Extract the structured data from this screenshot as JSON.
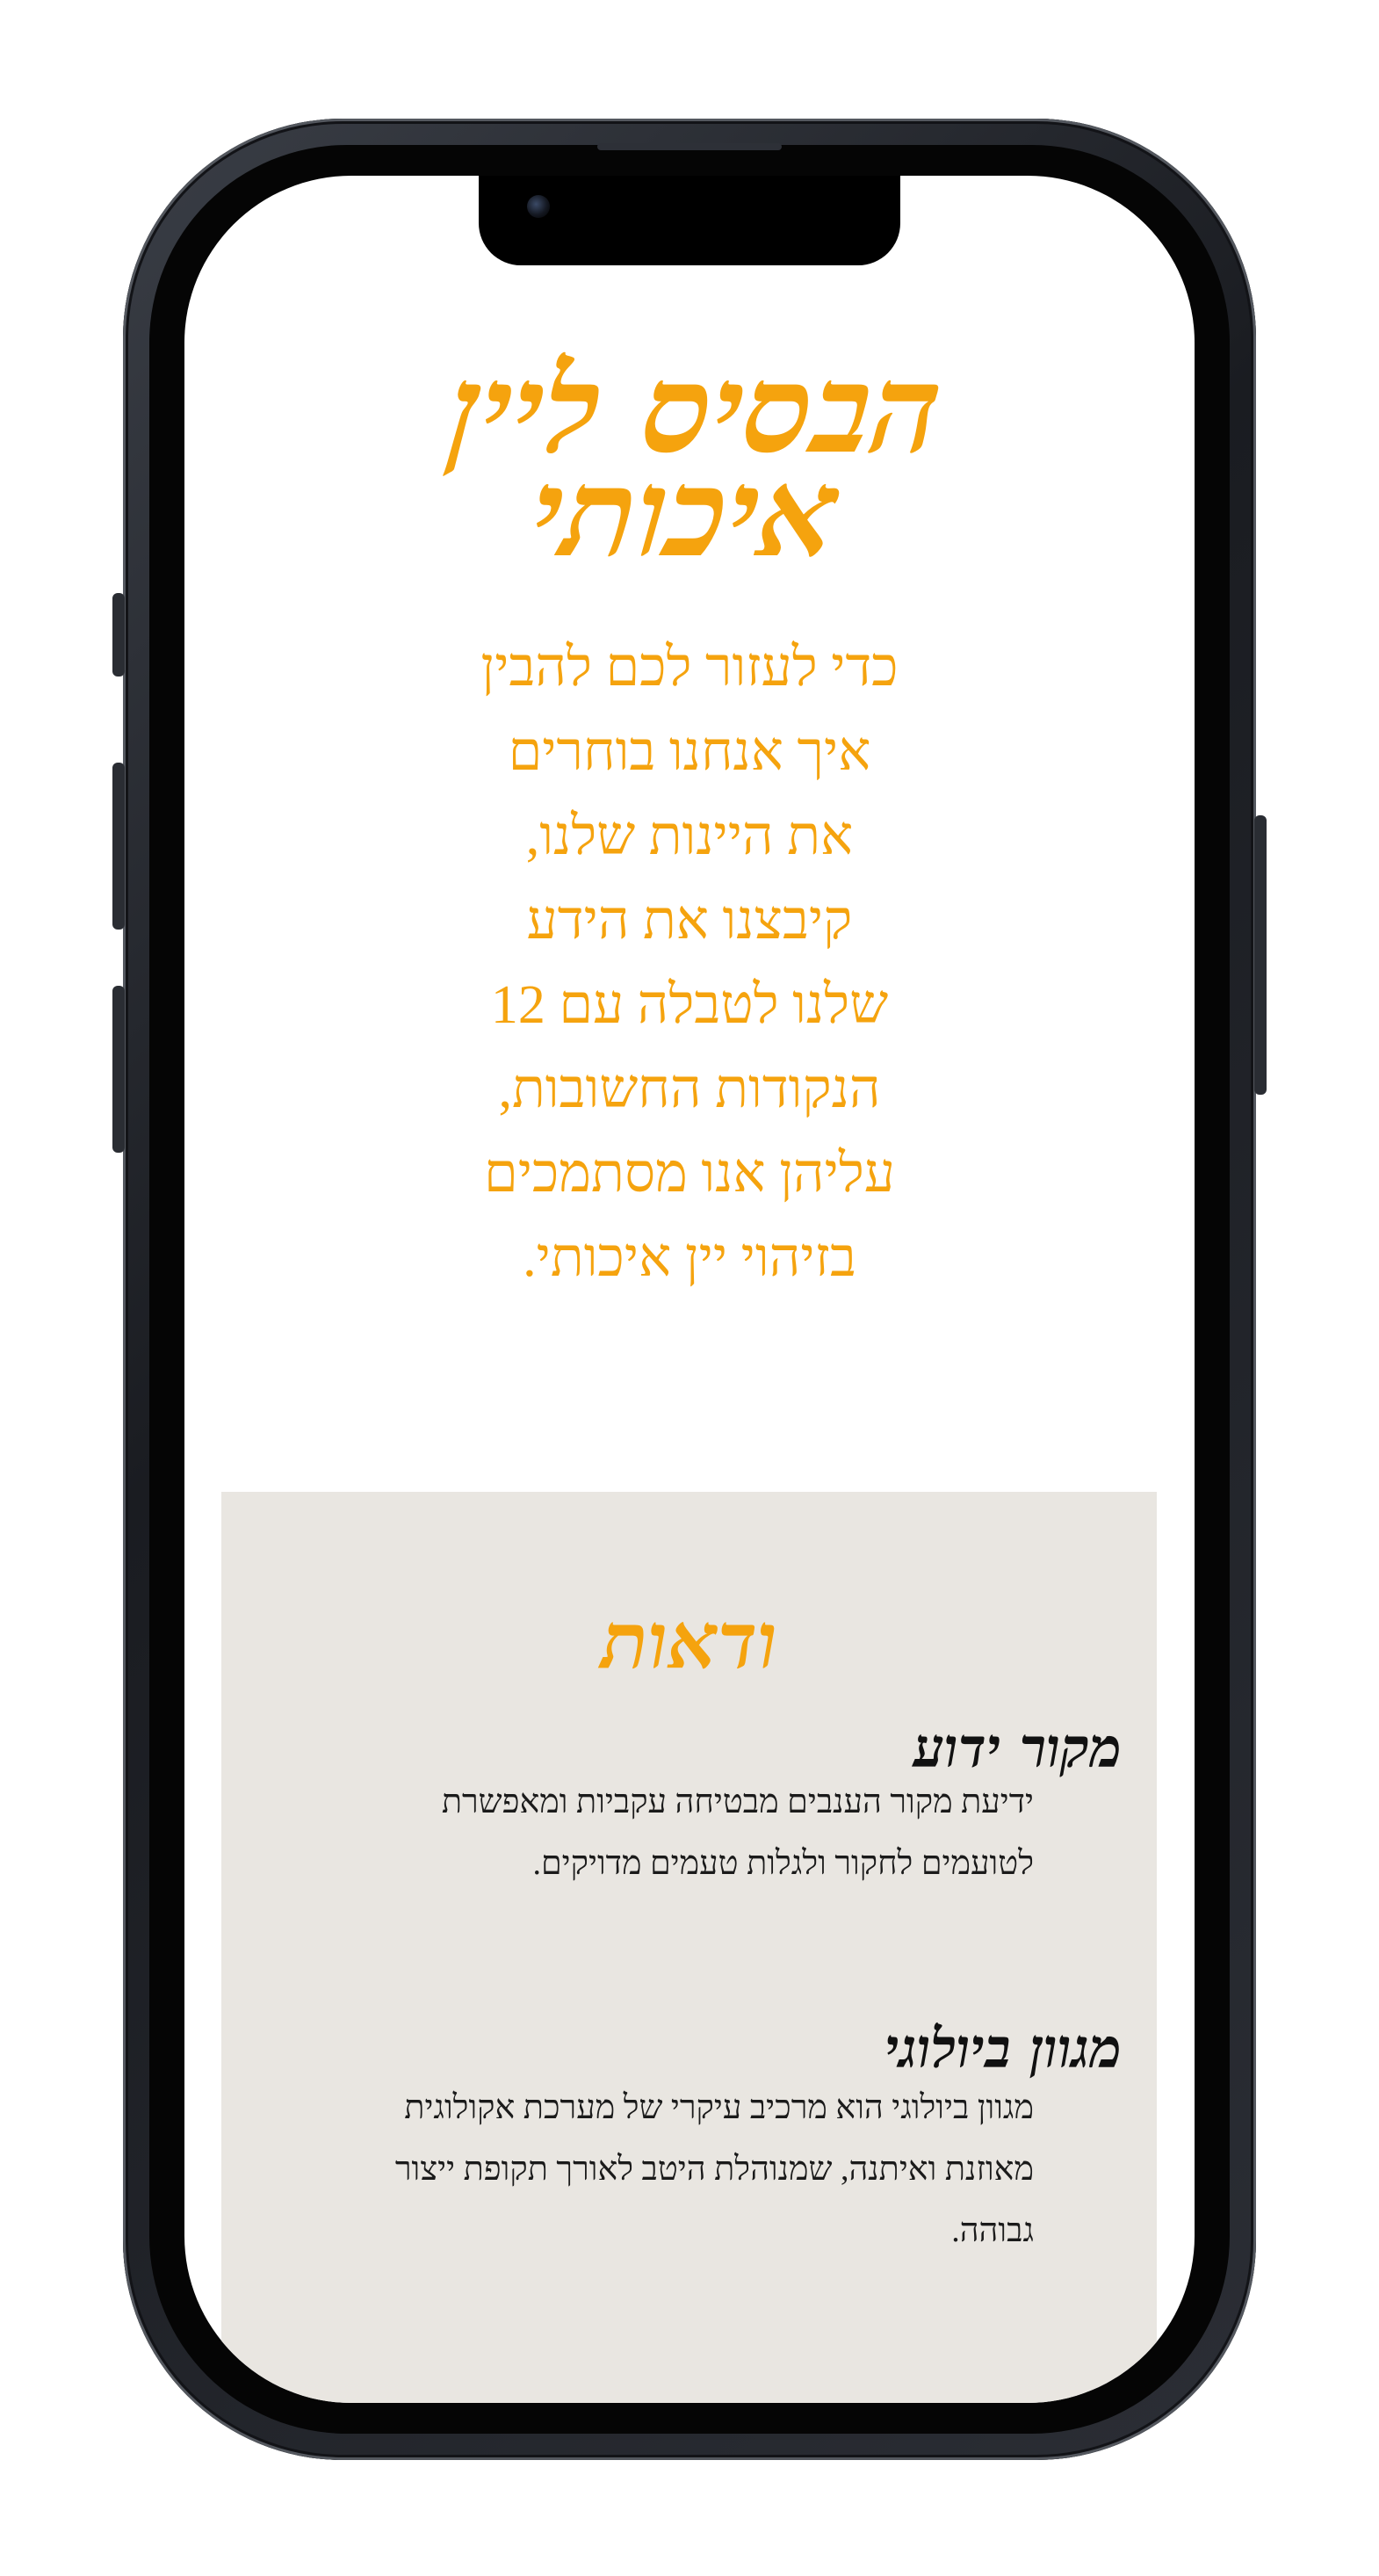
{
  "hero": {
    "title": "הבסיס ליין איכותי",
    "description": "כדי לעזור לכם להבין איך אנחנו בוחרים את היינות שלנו, קיבצנו את הידע שלנו לטבלה עם 12 הנקודות החשובות, עליהן אנו מסתמכים בזיהוי יין איכותי."
  },
  "section": {
    "title": "ודאות",
    "features": [
      {
        "heading": "מקור ידוע",
        "body": "ידיעת מקור הענבים מבטיחה עקביות ומאפשרת לטועמים לחקור ולגלות טעמים מדויקים."
      },
      {
        "heading": "מגוון ביולוגי",
        "body": "מגוון ביולוגי הוא מרכיב עיקרי של מערכת אקולוגית מאוזנת ואיתנה, שמנוהלת היטב לאורך תקופת ייצור גבוהה."
      }
    ]
  },
  "colors": {
    "accent": "#f5a30e",
    "panel_background": "#e9e6e1",
    "phone_frame": "#1a1c21"
  }
}
